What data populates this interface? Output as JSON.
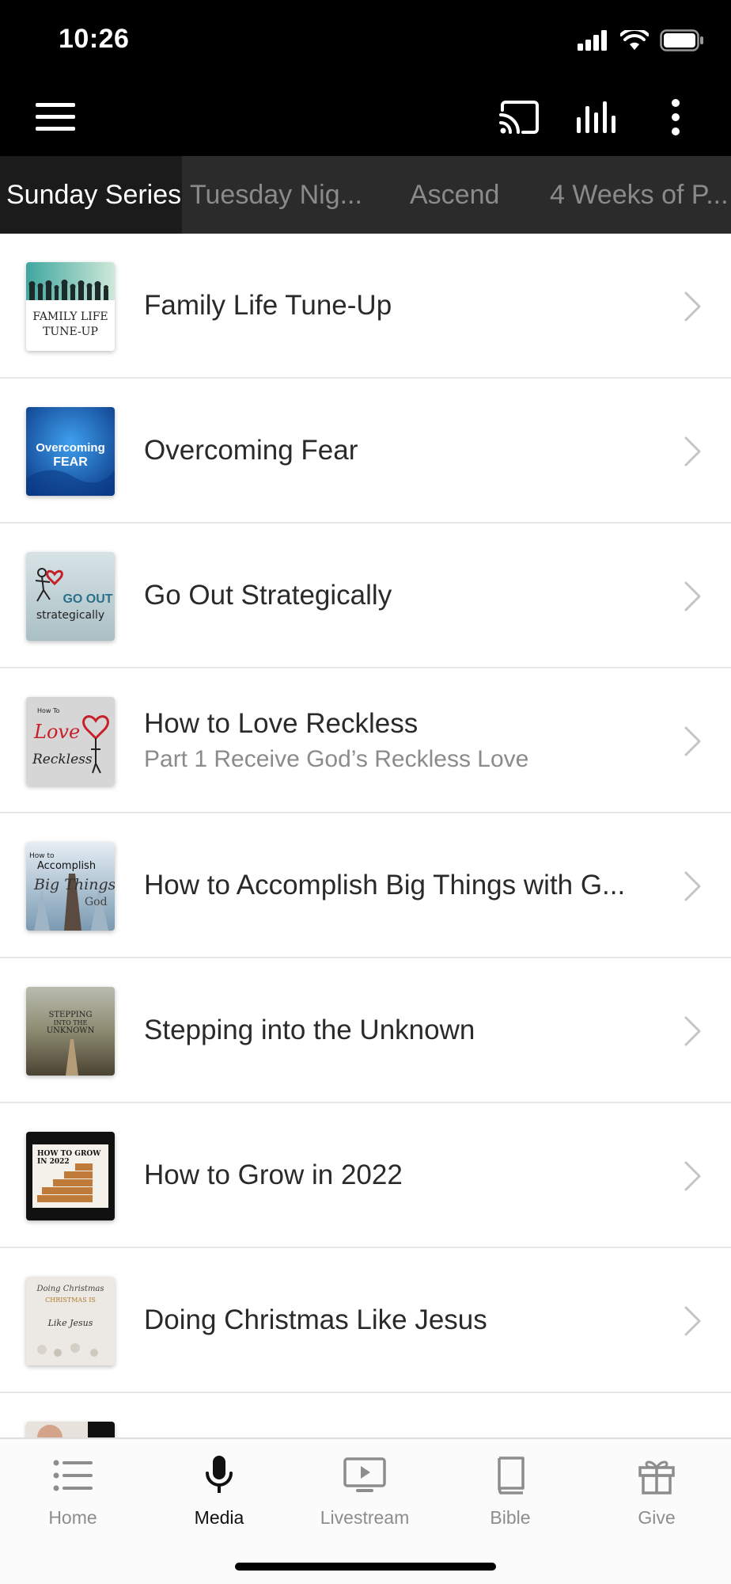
{
  "status_bar": {
    "time": "10:26"
  },
  "app_bar": {
    "menu_icon": "hamburger-icon",
    "cast_icon": "cast-icon",
    "audio_icon": "audio-bars-icon",
    "more_icon": "more-vertical-icon"
  },
  "tabs": [
    {
      "label": "Sunday Series",
      "active": true
    },
    {
      "label": "Tuesday Nig...",
      "active": false
    },
    {
      "label": "Ascend",
      "active": false
    },
    {
      "label": "4 Weeks of P...",
      "active": false
    }
  ],
  "series": [
    {
      "title": "Family Life Tune-Up",
      "subtitle": "",
      "thumb_text": [
        "FAMILY LIFE",
        "TUNE-UP"
      ]
    },
    {
      "title": "Overcoming Fear",
      "subtitle": "",
      "thumb_text": [
        "Overcoming",
        "FEAR"
      ]
    },
    {
      "title": "Go Out Strategically",
      "subtitle": "",
      "thumb_text": [
        "GO OUT",
        "strategically"
      ]
    },
    {
      "title": "How to Love Reckless",
      "subtitle": "Part 1 Receive God’s Reckless Love",
      "thumb_text": [
        "How To",
        "Love",
        "Reckless"
      ]
    },
    {
      "title": "How to Accomplish Big Things with G...",
      "subtitle": "",
      "thumb_text": [
        "How to",
        "Accomplish",
        "Big Things",
        "God"
      ]
    },
    {
      "title": "Stepping into the Unknown",
      "subtitle": "",
      "thumb_text": [
        "STEPPING",
        "INTO THE",
        "UNKNOWN"
      ]
    },
    {
      "title": "How to Grow in 2022",
      "subtitle": "",
      "thumb_text": [
        "HOW TO GROW",
        "IN 2022"
      ]
    },
    {
      "title": "Doing Christmas Like Jesus",
      "subtitle": "",
      "thumb_text": [
        "Doing Christmas",
        "CHRISTMAS IS",
        "Like Jesus"
      ]
    }
  ],
  "bottom_nav": [
    {
      "label": "Home",
      "icon": "list-icon",
      "active": false
    },
    {
      "label": "Media",
      "icon": "microphone-icon",
      "active": true
    },
    {
      "label": "Livestream",
      "icon": "tv-play-icon",
      "active": false
    },
    {
      "label": "Bible",
      "icon": "book-icon",
      "active": false
    },
    {
      "label": "Give",
      "icon": "gift-icon",
      "active": false
    }
  ],
  "colors": {
    "accent_active": "#111111",
    "inactive": "#8d8d8d",
    "tab_bg": "#2b2b2b",
    "header_bg": "#000000"
  }
}
